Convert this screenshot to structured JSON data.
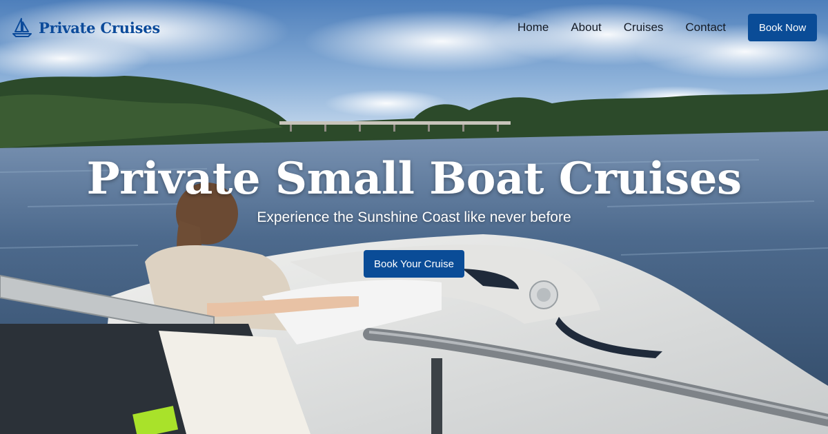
{
  "brand": {
    "name": "Private Cruises",
    "icon": "sailboat-icon",
    "color": "#0b4a9a"
  },
  "nav": {
    "items": [
      {
        "label": "Home"
      },
      {
        "label": "About"
      },
      {
        "label": "Cruises"
      },
      {
        "label": "Contact"
      }
    ],
    "cta_label": "Book Now",
    "cta_color": "#0a4c97"
  },
  "hero": {
    "title": "Private Small Boat Cruises",
    "subtitle": "Experience the Sunshine Coast like never before",
    "cta_label": "Book Your Cruise"
  },
  "background": {
    "description_icon": "photo-background"
  }
}
